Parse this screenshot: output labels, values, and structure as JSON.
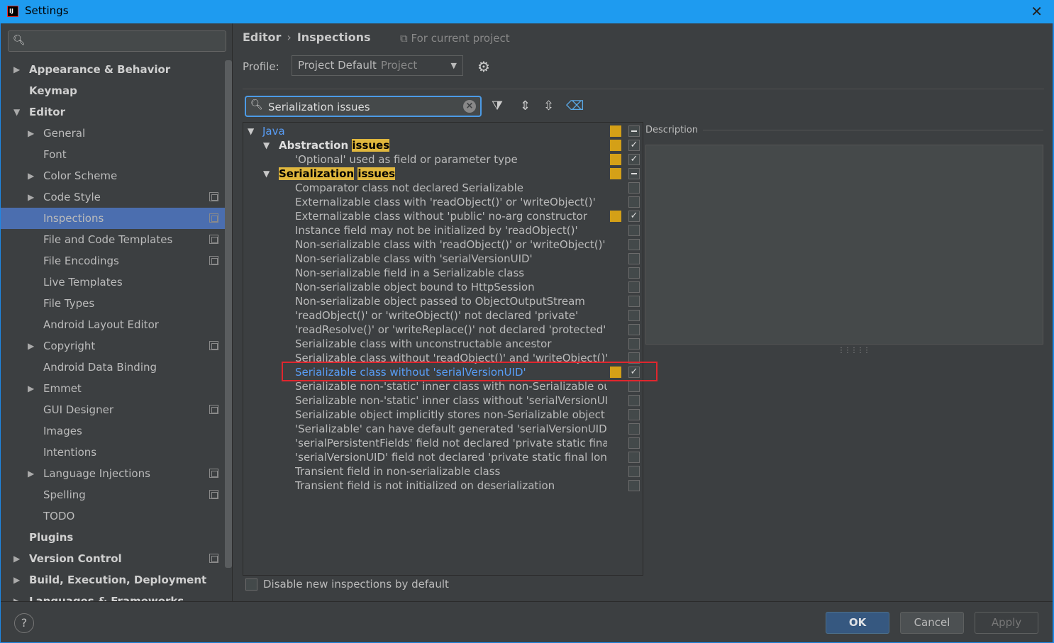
{
  "window": {
    "title": "Settings",
    "close_glyph": "✕"
  },
  "sidebar": {
    "search": {
      "placeholder": ""
    },
    "items": [
      {
        "label": "Appearance & Behavior",
        "expand": "right",
        "bold": true,
        "indent": 0
      },
      {
        "label": "Keymap",
        "expand": "none",
        "bold": true,
        "indent": 0
      },
      {
        "label": "Editor",
        "expand": "down",
        "bold": true,
        "indent": 0
      },
      {
        "label": "General",
        "expand": "right",
        "indent": 1
      },
      {
        "label": "Font",
        "expand": "none",
        "indent": 1
      },
      {
        "label": "Color Scheme",
        "expand": "right",
        "indent": 1
      },
      {
        "label": "Code Style",
        "expand": "right",
        "indent": 1,
        "project": true
      },
      {
        "label": "Inspections",
        "expand": "none",
        "indent": 1,
        "project": true,
        "selected": true
      },
      {
        "label": "File and Code Templates",
        "expand": "none",
        "indent": 1,
        "project": true
      },
      {
        "label": "File Encodings",
        "expand": "none",
        "indent": 1,
        "project": true
      },
      {
        "label": "Live Templates",
        "expand": "none",
        "indent": 1
      },
      {
        "label": "File Types",
        "expand": "none",
        "indent": 1
      },
      {
        "label": "Android Layout Editor",
        "expand": "none",
        "indent": 1
      },
      {
        "label": "Copyright",
        "expand": "right",
        "indent": 1,
        "project": true
      },
      {
        "label": "Android Data Binding",
        "expand": "none",
        "indent": 1
      },
      {
        "label": "Emmet",
        "expand": "right",
        "indent": 1
      },
      {
        "label": "GUI Designer",
        "expand": "none",
        "indent": 1,
        "project": true
      },
      {
        "label": "Images",
        "expand": "none",
        "indent": 1
      },
      {
        "label": "Intentions",
        "expand": "none",
        "indent": 1
      },
      {
        "label": "Language Injections",
        "expand": "right",
        "indent": 1,
        "project": true
      },
      {
        "label": "Spelling",
        "expand": "none",
        "indent": 1,
        "project": true
      },
      {
        "label": "TODO",
        "expand": "none",
        "indent": 1
      },
      {
        "label": "Plugins",
        "expand": "none",
        "bold": true,
        "indent": 0
      },
      {
        "label": "Version Control",
        "expand": "right",
        "bold": true,
        "indent": 0,
        "project": true
      },
      {
        "label": "Build, Execution, Deployment",
        "expand": "right",
        "bold": true,
        "indent": 0
      },
      {
        "label": "Languages & Frameworks",
        "expand": "right",
        "bold": true,
        "indent": 0
      }
    ]
  },
  "breadcrumb": {
    "parent": "Editor",
    "separator": "›",
    "current": "Inspections",
    "scope_note": "For current project"
  },
  "profile": {
    "label": "Profile:",
    "value": "Project Default",
    "scope": "Project"
  },
  "inspection_search": {
    "value": "Serialization issues"
  },
  "tree": [
    {
      "level": 0,
      "arrow": "down",
      "text": "Java",
      "style": "blue",
      "severity": true,
      "check": "partial"
    },
    {
      "level": 1,
      "arrow": "down",
      "parts": [
        [
          "Abstraction ",
          false
        ],
        [
          "issues",
          true
        ]
      ],
      "style": "bold",
      "severity": true,
      "check": "checked"
    },
    {
      "level": 2,
      "text": "'Optional' used as field or parameter type",
      "severity": true,
      "check": "checked"
    },
    {
      "level": 1,
      "arrow": "down",
      "parts": [
        [
          "Serialization",
          true
        ],
        [
          " ",
          false
        ],
        [
          "issues",
          true
        ]
      ],
      "style": "bold",
      "severity": true,
      "check": "partial"
    },
    {
      "level": 2,
      "text": "Comparator class not declared Serializable",
      "check": "unchecked"
    },
    {
      "level": 2,
      "text": "Externalizable class with 'readObject()' or 'writeObject()'",
      "check": "unchecked"
    },
    {
      "level": 2,
      "text": "Externalizable class without 'public' no-arg constructor",
      "severity": true,
      "check": "checked"
    },
    {
      "level": 2,
      "text": "Instance field may not be initialized by 'readObject()'",
      "check": "unchecked"
    },
    {
      "level": 2,
      "text": "Non-serializable class with 'readObject()' or 'writeObject()'",
      "check": "unchecked"
    },
    {
      "level": 2,
      "text": "Non-serializable class with 'serialVersionUID'",
      "check": "unchecked"
    },
    {
      "level": 2,
      "text": "Non-serializable field in a Serializable class",
      "check": "unchecked"
    },
    {
      "level": 2,
      "text": "Non-serializable object bound to HttpSession",
      "check": "unchecked"
    },
    {
      "level": 2,
      "text": "Non-serializable object passed to ObjectOutputStream",
      "check": "unchecked"
    },
    {
      "level": 2,
      "text": "'readObject()' or 'writeObject()' not declared 'private'",
      "check": "unchecked"
    },
    {
      "level": 2,
      "text": "'readResolve()' or 'writeReplace()' not declared 'protected'",
      "check": "unchecked"
    },
    {
      "level": 2,
      "text": "Serializable class with unconstructable ancestor",
      "check": "unchecked"
    },
    {
      "level": 2,
      "text": "Serializable class without 'readObject()' and 'writeObject()'",
      "check": "unchecked"
    },
    {
      "level": 2,
      "text": "Serializable class without 'serialVersionUID'",
      "style": "blue",
      "severity": true,
      "check": "checked",
      "highlighted": true
    },
    {
      "level": 2,
      "text": "Serializable non-'static' inner class with non-Serializable outer",
      "check": "unchecked"
    },
    {
      "level": 2,
      "text": "Serializable non-'static' inner class without 'serialVersionUID'",
      "check": "unchecked"
    },
    {
      "level": 2,
      "text": "Serializable object implicitly stores non-Serializable object",
      "check": "unchecked"
    },
    {
      "level": 2,
      "text": "'Serializable' can have default generated 'serialVersionUID'",
      "check": "unchecked"
    },
    {
      "level": 2,
      "text": "'serialPersistentFields' field not declared 'private static final ObjectStreamField[]'",
      "check": "unchecked"
    },
    {
      "level": 2,
      "text": "'serialVersionUID' field not declared 'private static final long'",
      "check": "unchecked"
    },
    {
      "level": 2,
      "text": "Transient field in non-serializable class",
      "check": "unchecked"
    },
    {
      "level": 2,
      "text": "Transient field is not initialized on deserialization",
      "check": "unchecked"
    }
  ],
  "description": {
    "label": "Description"
  },
  "disable_new": {
    "label": "Disable new inspections by default",
    "checked": false
  },
  "buttons": {
    "ok": "OK",
    "cancel": "Cancel",
    "apply": "Apply",
    "help": "?"
  },
  "colors": {
    "accent": "#4b6eaf",
    "severity": "#d4a017",
    "highlight": "#e0b73d",
    "link": "#589df6",
    "red_box": "#e0262e"
  }
}
